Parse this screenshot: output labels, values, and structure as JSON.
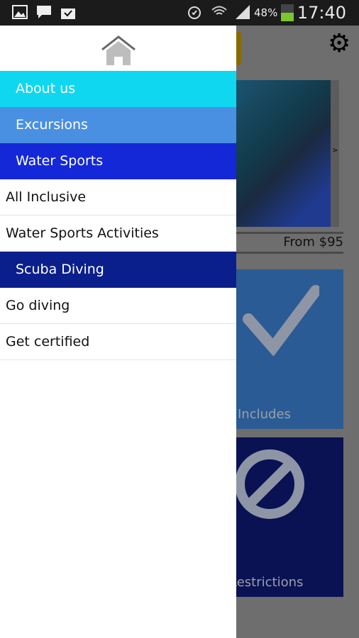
{
  "status_bar": {
    "battery": "48%",
    "time": "17:40",
    "battery_level": 0.48,
    "icons": [
      "gallery-icon",
      "bbm-icon",
      "shopping-bag-icon",
      "alarm-icon",
      "wifi-icon",
      "signal-icon",
      "battery-icon"
    ]
  },
  "drawer": {
    "home_icon": "home-icon",
    "items": [
      {
        "label": "About us",
        "type": "section",
        "color": "#10d7f0"
      },
      {
        "label": "Excursions",
        "type": "section",
        "color": "#4a90e2"
      },
      {
        "label": "Water Sports",
        "type": "section",
        "color": "#1428d8"
      },
      {
        "label": "All Inclusive",
        "type": "item"
      },
      {
        "label": "Water Sports Activities",
        "type": "item"
      },
      {
        "label": "Scuba Diving",
        "type": "section",
        "color": "#0a1f8c"
      },
      {
        "label": "Go diving",
        "type": "item"
      },
      {
        "label": "Get certified",
        "type": "item"
      }
    ]
  },
  "background": {
    "settings_icon": "gear-icon",
    "gallery_next": ">",
    "price": "From $95",
    "tiles": [
      {
        "label": "Includes",
        "icon": "check-icon"
      },
      {
        "label": "Restrictions",
        "icon": "prohibited-icon"
      }
    ]
  }
}
